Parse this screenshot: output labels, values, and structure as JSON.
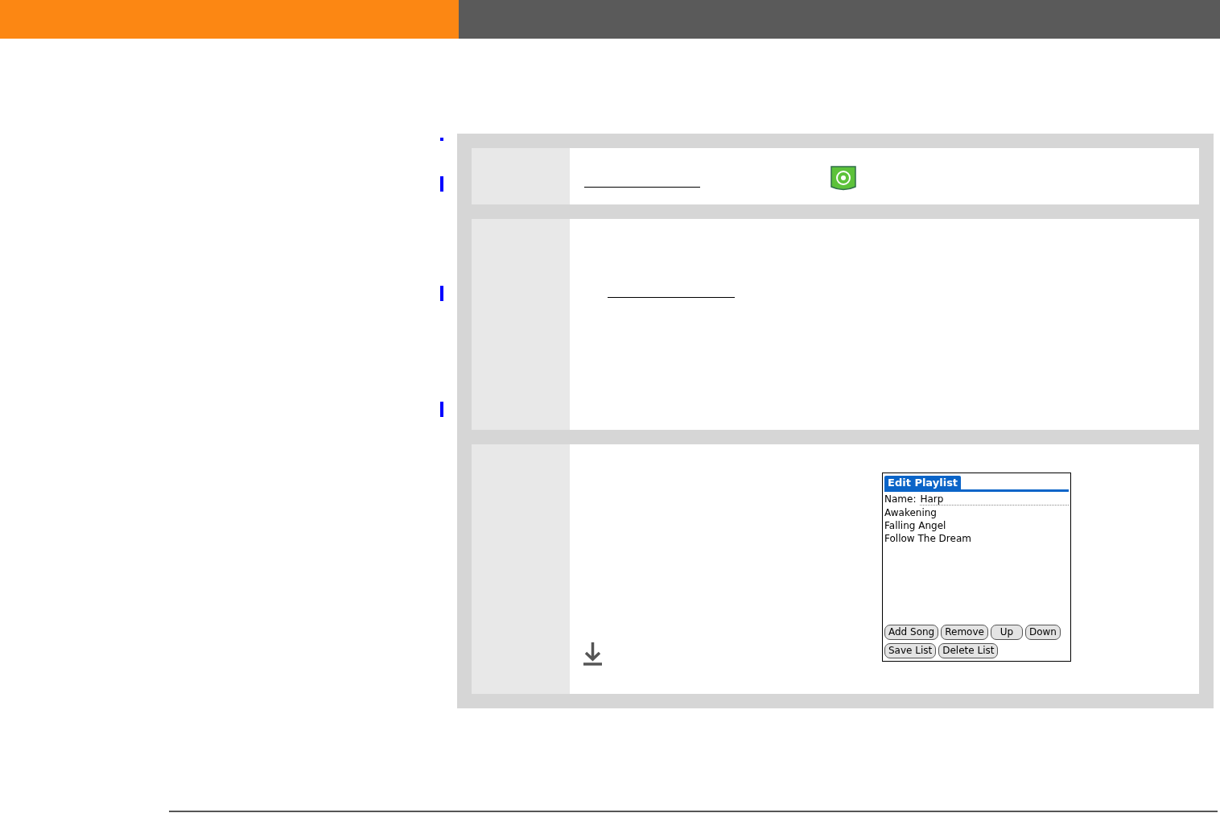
{
  "device_screen": {
    "title": "Edit Playlist",
    "name_label": "Name:",
    "name_value": "Harp",
    "songs": [
      "Awakening",
      "Falling Angel",
      "Follow The Dream"
    ],
    "button_rows": [
      {
        "buttons": [
          "Add Song",
          "Remove",
          "Up",
          "Down"
        ]
      },
      {
        "buttons": [
          "Save List",
          "Delete List"
        ]
      }
    ]
  }
}
